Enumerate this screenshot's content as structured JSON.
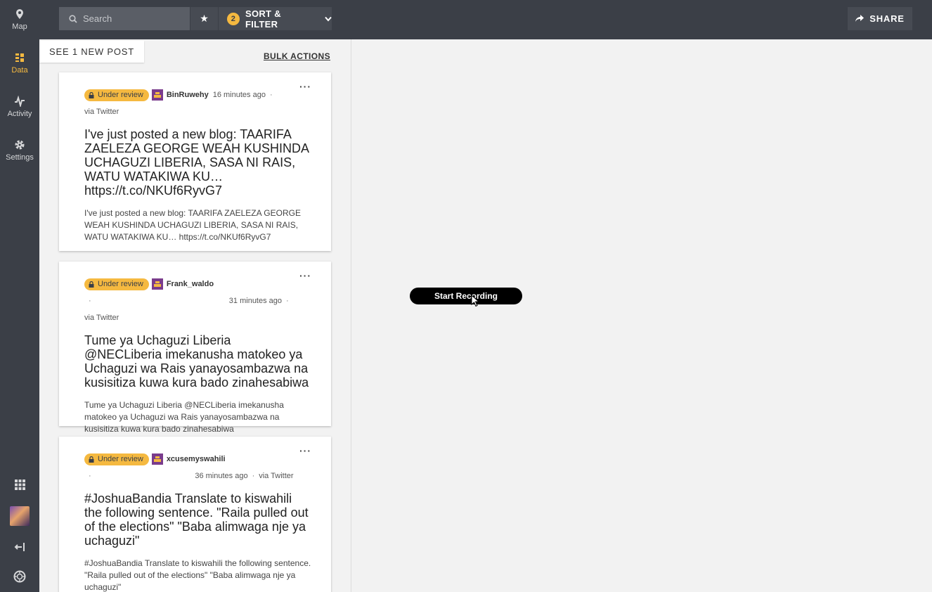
{
  "sidebar": {
    "items": [
      {
        "label": "Map",
        "icon": "map-pin-icon"
      },
      {
        "label": "Data",
        "icon": "data-list-icon"
      },
      {
        "label": "Activity",
        "icon": "activity-pulse-icon"
      },
      {
        "label": "Settings",
        "icon": "gear-icon"
      }
    ],
    "active_color": "#f5b940"
  },
  "topbar": {
    "search_placeholder": "Search",
    "filter_count": "2",
    "sort_filter_label": "SORT & FILTER",
    "share_label": "SHARE"
  },
  "feed": {
    "new_post_label": "SEE 1 NEW POST",
    "bulk_actions_label": "BULK ACTIONS",
    "posts": [
      {
        "status": "Under review",
        "author": "BinRuwehy",
        "time": "16 minutes ago",
        "source": "via Twitter",
        "title": "I've just posted a new blog: TAARIFA ZAELEZA GEORGE WEAH KUSHINDA UCHAGUZI LIBERIA, SASA NI RAIS, WATU WATAKIWA KU… https://t.co/NKUf6RyvG7",
        "body": "I've just posted a new blog: TAARIFA ZAELEZA GEORGE WEAH KUSHINDA UCHAGUZI LIBERIA, SASA NI RAIS, WATU WATAKIWA KU… https://t.co/NKUf6RyvG7"
      },
      {
        "status": "Under review",
        "author": "Frank_waldo",
        "time": "31 minutes ago",
        "source": "via Twitter",
        "title": "Tume ya Uchaguzi Liberia @NECLiberia imekanusha matokeo ya Uchaguzi wa Rais yanayosambazwa na kusisitiza kuwa kura bado zinahesabiwa",
        "body": "Tume ya Uchaguzi Liberia @NECLiberia imekanusha matokeo ya Uchaguzi wa Rais yanayosambazwa na kusisitiza kuwa kura bado zinahesabiwa"
      },
      {
        "status": "Under review",
        "author": "xcusemyswahili",
        "time": "36 minutes ago",
        "source": "via Twitter",
        "title": "#JoshuaBandia Translate to kiswahili the following sentence. \"Raila pulled out of the elections\" \"Baba alimwaga nje ya uchaguzi\"",
        "body": "#JoshuaBandia Translate to kiswahili the following sentence. \"Raila pulled out of the elections\" \"Baba alimwaga nje ya uchaguzi\""
      }
    ]
  },
  "recording": {
    "label": "Start Recording"
  }
}
